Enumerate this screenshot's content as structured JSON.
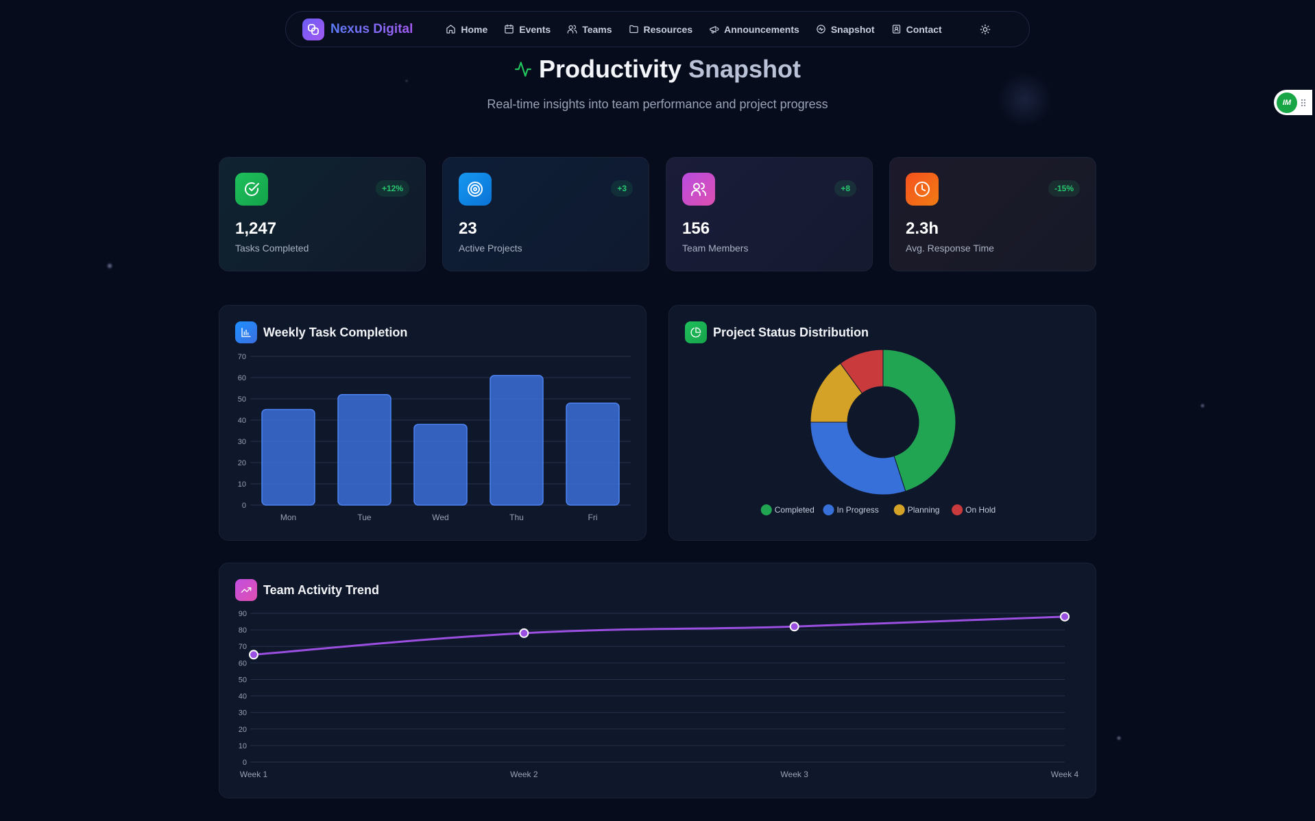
{
  "nav": {
    "brand": "Nexus Digital",
    "items": [
      {
        "label": "Home",
        "icon": "home-icon"
      },
      {
        "label": "Events",
        "icon": "calendar-icon"
      },
      {
        "label": "Teams",
        "icon": "users-icon"
      },
      {
        "label": "Resources",
        "icon": "folder-icon"
      },
      {
        "label": "Announcements",
        "icon": "megaphone-icon"
      },
      {
        "label": "Snapshot",
        "icon": "activity-icon"
      },
      {
        "label": "Contact",
        "icon": "contact-icon"
      }
    ],
    "theme_toggle_icon": "sun-icon"
  },
  "widget": {
    "badge": "IM"
  },
  "header": {
    "title_main": "Productivity",
    "title_accent": "Snapshot",
    "subtitle": "Real-time insights into team performance and project progress"
  },
  "stats": [
    {
      "value": "1,247",
      "label": "Tasks Completed",
      "change": "+12%",
      "icon": "check-circle-icon",
      "color": "#1fbf5c"
    },
    {
      "value": "23",
      "label": "Active Projects",
      "change": "+3",
      "icon": "target-icon",
      "color": "#1597f0"
    },
    {
      "value": "156",
      "label": "Team Members",
      "change": "+8",
      "icon": "users-icon",
      "color": "#b94ce0"
    },
    {
      "value": "2.3h",
      "label": "Avg. Response Time",
      "change": "-15%",
      "icon": "clock-icon",
      "color": "#f5511e"
    }
  ],
  "panels": {
    "weekly": {
      "title": "Weekly Task Completion",
      "icon": "bar-chart-icon"
    },
    "status": {
      "title": "Project Status Distribution",
      "icon": "pie-chart-icon"
    },
    "trend": {
      "title": "Team Activity Trend",
      "icon": "trending-up-icon"
    }
  },
  "chart_data": [
    {
      "type": "bar",
      "title": "Weekly Task Completion",
      "categories": [
        "Mon",
        "Tue",
        "Wed",
        "Thu",
        "Fri"
      ],
      "values": [
        45,
        52,
        38,
        61,
        48
      ],
      "ylim": [
        0,
        70
      ],
      "yticks": [
        0,
        10,
        20,
        30,
        40,
        50,
        60,
        70
      ],
      "color": "#3b6fd8",
      "grid": true
    },
    {
      "type": "pie",
      "title": "Project Status Distribution",
      "donut": true,
      "labels": [
        "Completed",
        "In Progress",
        "Planning",
        "On Hold"
      ],
      "values": [
        45,
        30,
        15,
        10
      ],
      "colors": [
        "#22a553",
        "#3770d8",
        "#d4a226",
        "#c93a3d"
      ],
      "legend": "bottom"
    },
    {
      "type": "line",
      "title": "Team Activity Trend",
      "x": [
        "Week 1",
        "Week 2",
        "Week 3",
        "Week 4"
      ],
      "values": [
        65,
        78,
        82,
        88
      ],
      "ylim": [
        0,
        90
      ],
      "yticks": [
        0,
        10,
        20,
        30,
        40,
        50,
        60,
        70,
        80,
        90
      ],
      "color": "#9b4fe0",
      "grid": true
    }
  ]
}
